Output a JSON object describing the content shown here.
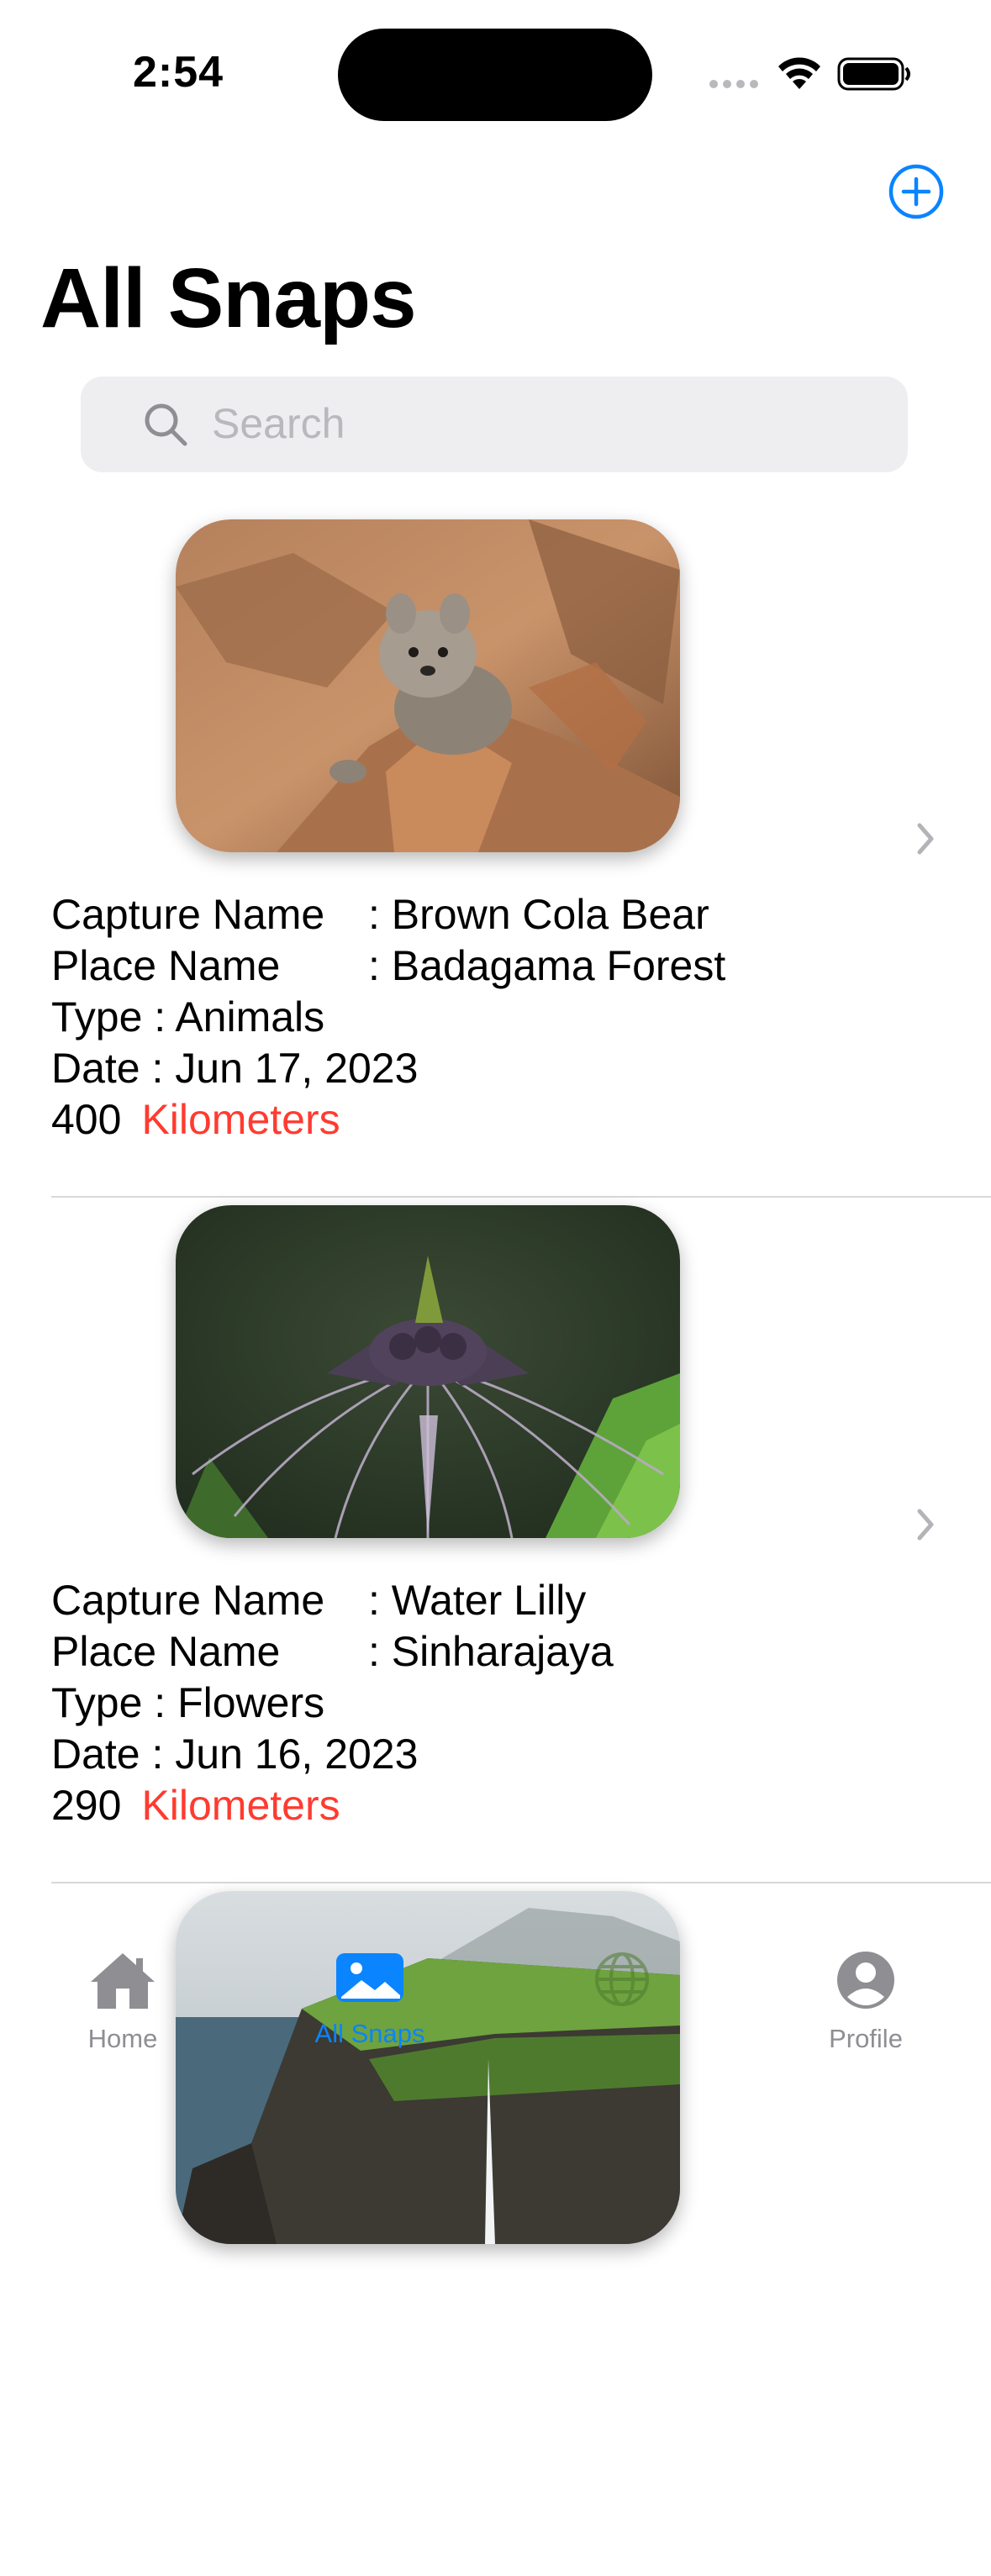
{
  "status_bar": {
    "time": "2:54"
  },
  "header": {
    "title": "All Snaps",
    "add_icon": "plus-circle-icon"
  },
  "search": {
    "placeholder": "Search",
    "value": ""
  },
  "snaps": [
    {
      "capture_label": "Capture Name",
      "capture_value": ": Brown Cola Bear",
      "place_label": "Place Name",
      "place_value": ": Badagama Forest",
      "type": "Type : Animals",
      "date": "Date : Jun 17, 2023",
      "distance": "400",
      "unit": "Kilometers"
    },
    {
      "capture_label": "Capture Name",
      "capture_value": ": Water Lilly",
      "place_label": "Place Name",
      "place_value": ": Sinharajaya",
      "type": "Type : Flowers",
      "date": "Date : Jun 16, 2023",
      "distance": "290",
      "unit": "Kilometers"
    }
  ],
  "tabs": [
    {
      "label": "Home",
      "icon": "house-icon"
    },
    {
      "label": "All Snaps",
      "icon": "photo-icon",
      "selected": true
    },
    {
      "label": "",
      "icon": "globe-icon"
    },
    {
      "label": "Profile",
      "icon": "person-circle-icon"
    }
  ],
  "colors": {
    "accent": "#0a84ff",
    "unit_red": "#ff3b30",
    "search_bg": "#eeeef0"
  }
}
